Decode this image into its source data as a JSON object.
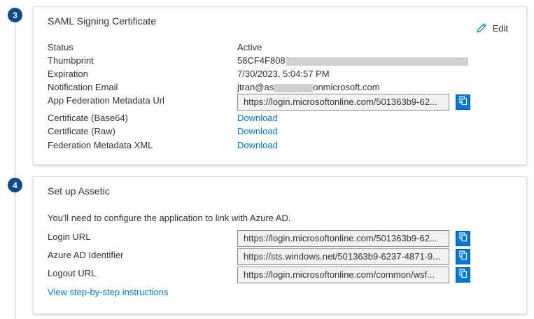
{
  "steps": [
    {
      "number": "3"
    },
    {
      "number": "4"
    }
  ],
  "saml_card": {
    "title": "SAML Signing Certificate",
    "edit_label": "Edit",
    "rows": [
      {
        "label": "Status",
        "value": "Active"
      },
      {
        "label": "Thumbprint",
        "value": "58CF4F808"
      },
      {
        "label": "Expiration",
        "value": "7/30/2023, 5:04:57 PM"
      },
      {
        "label": "Notification Email",
        "value_prefix": "jtran@as",
        "value_suffix": "onmicrosoft.com"
      },
      {
        "label": "App Federation Metadata Url",
        "value": "https://login.microsoftonline.com/501363b9-62..."
      },
      {
        "label": "Certificate (Base64)",
        "value": "Download"
      },
      {
        "label": "Certificate (Raw)",
        "value": "Download"
      },
      {
        "label": "Federation Metadata XML",
        "value": "Download"
      }
    ]
  },
  "setup_card": {
    "title": "Set up Assetic",
    "description": "You'll need to configure the application to link with Azure AD.",
    "fields": [
      {
        "label": "Login URL",
        "value": "https://login.microsoftonline.com/501363b9-62..."
      },
      {
        "label": "Azure AD Identifier",
        "value": "https://sts.windows.net/501363b9-6237-4871-9..."
      },
      {
        "label": "Logout URL",
        "value": "https://login.microsoftonline.com/common/wsf..."
      }
    ],
    "instructions_link": "View step-by-step instructions"
  },
  "icons": {
    "edit": "pencil-icon",
    "copy": "copy-icon"
  },
  "colors": {
    "accent": "#0078d4",
    "step_badge": "#0f4a8a",
    "masked": "#d2d0ce"
  }
}
